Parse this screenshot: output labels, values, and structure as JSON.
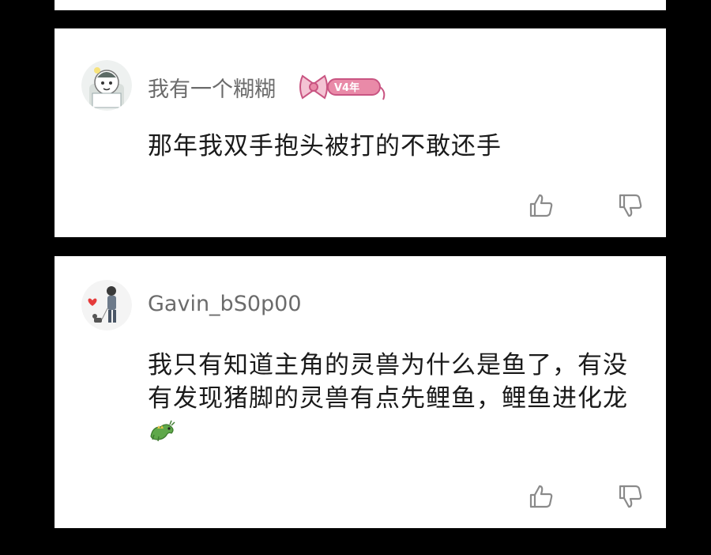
{
  "comments": [
    {
      "username": "我有一个糊糊",
      "badge_text": "V4年",
      "text": "那年我双手抱头被打的不敢还手"
    },
    {
      "username": "Gavin_bS0p00",
      "text": "我只有知道主角的灵兽为什么是鱼了，有没有发现猪脚的灵兽有点先鲤鱼，鲤鱼进化龙"
    }
  ],
  "icons": {
    "like": "thumbs-up-icon",
    "dislike": "thumbs-down-icon",
    "emoji": "dragon-emoji-icon"
  },
  "colors": {
    "background": "#000000",
    "card": "#ffffff",
    "username": "#6b6b6b",
    "text": "#1a1a1a",
    "badge_pink": "#e98aa8",
    "icon_gray": "#8a8a8a"
  }
}
